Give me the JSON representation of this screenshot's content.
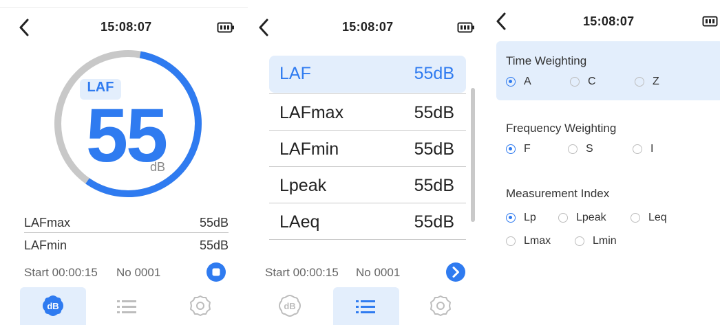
{
  "screen1": {
    "time": "15:08:07",
    "measure_tag": "LAF",
    "big_value": "55",
    "unit": "dB",
    "rows": [
      {
        "label": "LAFmax",
        "value": "55dB"
      },
      {
        "label": "LAFmin",
        "value": "55dB"
      }
    ],
    "start_label": "Start 00:00:15",
    "record_no": "No 0001",
    "gauge_level_percent": 57
  },
  "screen2": {
    "time": "15:08:07",
    "items": [
      {
        "label": "LAF",
        "value": "55dB"
      },
      {
        "label": "LAFmax",
        "value": "55dB"
      },
      {
        "label": "LAFmin",
        "value": "55dB"
      },
      {
        "label": "Lpeak",
        "value": "55dB"
      },
      {
        "label": "LAeq",
        "value": "55dB"
      }
    ],
    "start_label": "Start 00:00:15",
    "record_no": "No 0001"
  },
  "screen3": {
    "time": "15:08:07",
    "time_weighting": {
      "title": "Time Weighting",
      "options": [
        "A",
        "C",
        "Z"
      ],
      "selected": "A"
    },
    "frequency_weighting": {
      "title": "Frequency Weighting",
      "options": [
        "F",
        "S",
        "I"
      ],
      "selected": "F"
    },
    "measurement_index": {
      "title": "Measurement Index",
      "options": [
        "Lp",
        "Lpeak",
        "Leq",
        "Lmax",
        "Lmin"
      ],
      "selected": "Lp"
    }
  },
  "icons": {
    "back": "chevron-left-icon",
    "battery": "battery-icon",
    "stop": "stop-icon",
    "next": "chevron-right-icon",
    "db": "db-icon",
    "list": "list-icon",
    "settings": "gear-icon"
  },
  "colors": {
    "accent": "#2f7bf0",
    "selected_bg": "#e3eefc",
    "ring_track": "#c8c8c8"
  }
}
